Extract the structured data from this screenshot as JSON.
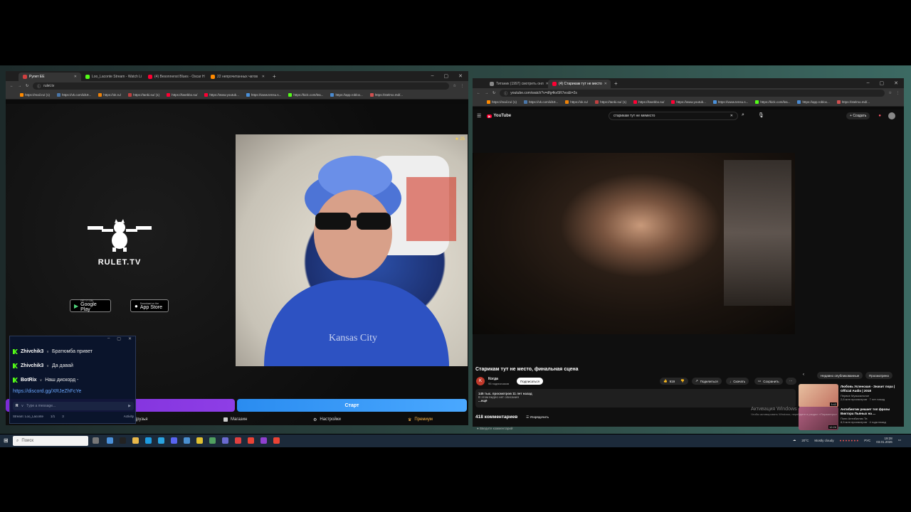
{
  "left_browser": {
    "tabs": [
      {
        "label": "Рулет ЕЕ",
        "active": true,
        "color": "#d04040"
      },
      {
        "label": "Loo_Laconte Stream - Watch Li",
        "active": false,
        "color": "#53fc18"
      },
      {
        "label": "(4) Besonnenst Blues - Oscar H",
        "active": false,
        "color": "#ff0033"
      },
      {
        "label": "22 непрочитанных чатов",
        "active": false,
        "color": "#ff8a00"
      }
    ],
    "url": "rulet.tv",
    "bookmarks": [
      "https://mail.ru/ (1)",
      "https://vk.com/id19...",
      "https://ok.ru/",
      "https://tanki.su/ (1)",
      "https://kwebbo.su/",
      "https://www.youtub...",
      "https://www.tensu.s...",
      "https://kick.com/lea...",
      "https://app.roblox...",
      "https://stelmo.md/..."
    ]
  },
  "rulet": {
    "brand": "RULET.TV",
    "google_play": {
      "small": "GET IT ON",
      "label": "Google Play"
    },
    "app_store": {
      "small": "Download on the",
      "label": "App Store"
    },
    "camera_stars": "25",
    "start_button": "Старт",
    "nav": {
      "friends": "Друзья",
      "shop": "Магазин",
      "settings": "Настройки",
      "premium": "Премиум"
    }
  },
  "chat": {
    "messages": [
      {
        "user": "Zhivchik3",
        "text": "Братюмба привет"
      },
      {
        "user": "Zhivchik3",
        "text": "Да давай"
      },
      {
        "user": "BotRix",
        "text": "Наш дискорд -"
      }
    ],
    "link": "https://discord.gg/XRJeZhFcYe",
    "input_placeholder": "Type a message...",
    "status_channel": "Stream: Loo_Laconte",
    "status_count": "1/1",
    "status_viewers": "3",
    "status_right": "Activity"
  },
  "right_browser": {
    "tabs": [
      {
        "label": "Титаник (1997) смотреть онл",
        "active": false,
        "color": "#888888"
      },
      {
        "label": "(4) Старикам тут не место",
        "active": true,
        "color": "#ff0033"
      }
    ],
    "url": "youtube.com/watch?v=dfg4kv5R7eo&t=2s",
    "bookmarks": [
      "https://mail.ru/ (1)",
      "https://vk.com/id19...",
      "https://ok.ru/",
      "https://tanki.su/ (1)",
      "https://kwebbo.su/",
      "https://www.youtub...",
      "https://www.tensu.s...",
      "https://kick.com/lea...",
      "https://app.roblox...",
      "https://stelmo.md/..."
    ]
  },
  "youtube": {
    "logo": "YouTube",
    "search_query": "старикам тут не меместо",
    "create_label": "Создать",
    "video_title": "Старикам тут не место, финальная сцена",
    "channel_name": "Когда",
    "channel_subs": "95 подписчиков",
    "subscribe_label": "Подписаться",
    "likes": "919",
    "share_label": "Поделиться",
    "download_label": "Скачать",
    "save_label": "Сохранить",
    "views_line": "145 тыс. просмотров  11 лет назад",
    "desc_line": "В этом видео нет описания",
    "desc_more": "...ещё",
    "comments_count": "418 комментариев",
    "sort_label": "Упорядочить",
    "add_comment": "Введите комментарий",
    "chips": [
      "Недавно опубликованные",
      "Просмотрено"
    ],
    "recommendations": [
      {
        "title": "Любовь Успенская - Значит пора | Official Audio | 2018",
        "channel": "Первое Музыкальное",
        "meta": "2,6 млн просмотров · 7 лет назад",
        "duration": "3:42",
        "color": "#c07060"
      },
      {
        "title": "Антибиотик решает топ фразы Виктора Пьяных на ...",
        "channel": "Попи Антибиотик Тв",
        "meta": "8,5 млн просмотров · 4 года назад",
        "duration": "12:24",
        "color": "#b06080"
      }
    ]
  },
  "watermark": {
    "line1": "Активация Windows",
    "line2": "Чтобы активировать Windows, перейдите в раздел «Параметры»"
  },
  "taskbar": {
    "search_placeholder": "Поиск",
    "weather": "Mostly cloudy",
    "temp": "20°C",
    "lang": "РУС",
    "time": "19:28",
    "date": "03.01.2026"
  }
}
